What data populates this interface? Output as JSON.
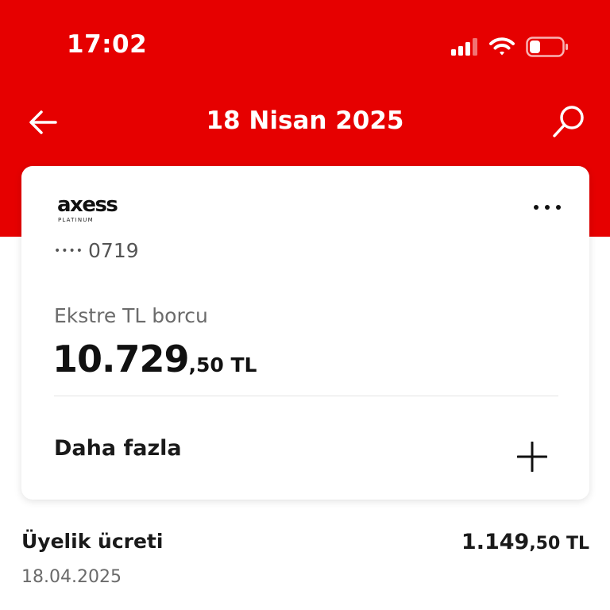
{
  "status_bar": {
    "time": "17:02",
    "icons": [
      "signal-icon",
      "wifi-icon",
      "battery-low-icon"
    ]
  },
  "nav": {
    "title": "18 Nisan 2025",
    "back_icon": "back-arrow-icon",
    "search_icon": "search-icon"
  },
  "colors": {
    "brand_red": "#e60000",
    "battery_red": "#e60000"
  },
  "card": {
    "brand": "axess",
    "tier": "PLATINUM",
    "masked_dots": "••••",
    "last_digits": "0719",
    "balance_label": "Ekstre TL borcu",
    "balance_main": "10.729",
    "balance_decimal": ",50 TL",
    "more_label": "Daha fazla",
    "menu_icon": "more-dots-icon",
    "expand_icon": "plus-icon"
  },
  "transactions": [
    {
      "title": "Üyelik ücreti",
      "date": "18.04.2025",
      "amount_main": "1.149",
      "amount_decimal": ",50 TL"
    }
  ]
}
